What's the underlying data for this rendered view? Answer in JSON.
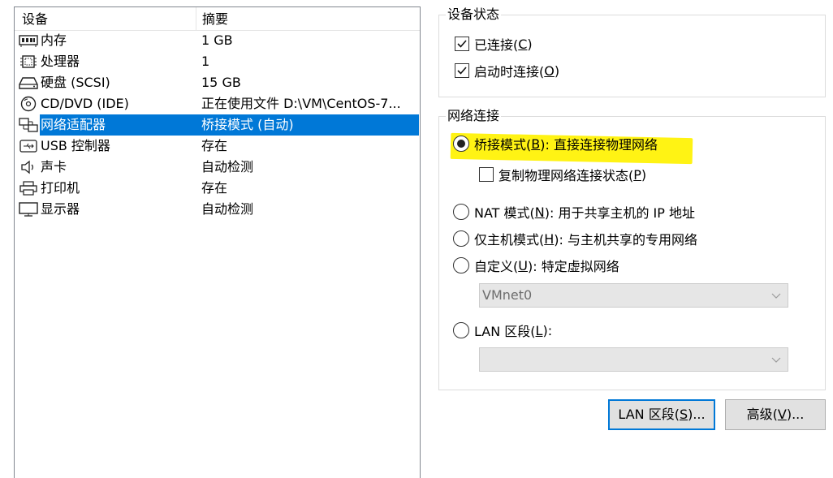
{
  "device_list": {
    "header": {
      "device": "设备",
      "summary": "摘要"
    },
    "rows": [
      {
        "icon": "memory-icon",
        "name": "内存",
        "summary": "1 GB",
        "selected": false
      },
      {
        "icon": "processor-icon",
        "name": "处理器",
        "summary": "1",
        "selected": false
      },
      {
        "icon": "hard-disk-icon",
        "name": "硬盘 (SCSI)",
        "summary": "15 GB",
        "selected": false
      },
      {
        "icon": "cd-dvd-icon",
        "name": "CD/DVD (IDE)",
        "summary": "正在使用文件 D:\\VM\\CentOS-7...",
        "selected": false
      },
      {
        "icon": "network-adapter-icon",
        "name": "网络适配器",
        "summary": "桥接模式 (自动)",
        "selected": true
      },
      {
        "icon": "usb-icon",
        "name": "USB 控制器",
        "summary": "存在",
        "selected": false
      },
      {
        "icon": "speaker-icon",
        "name": "声卡",
        "summary": "自动检测",
        "selected": false
      },
      {
        "icon": "printer-icon",
        "name": "打印机",
        "summary": "存在",
        "selected": false
      },
      {
        "icon": "monitor-icon",
        "name": "显示器",
        "summary": "自动检测",
        "selected": false
      }
    ]
  },
  "device_status": {
    "title": "设备状态",
    "connected": {
      "label": "已连接(",
      "key": "C",
      "suffix": ")",
      "checked": true
    },
    "connect_at_power_on": {
      "label": "启动时连接(",
      "key": "O",
      "suffix": ")",
      "checked": true
    }
  },
  "network_connection": {
    "title": "网络连接",
    "bridged": {
      "label": "桥接模式(",
      "key": "B",
      "suffix": "): 直接连接物理网络",
      "checked": true
    },
    "replicate": {
      "label": "复制物理网络连接状态(",
      "key": "P",
      "suffix": ")",
      "checked": false
    },
    "nat": {
      "label": "NAT 模式(",
      "key": "N",
      "suffix": "): 用于共享主机的 IP 地址",
      "checked": false
    },
    "host_only": {
      "label": "仅主机模式(",
      "key": "H",
      "suffix": "): 与主机共享的专用网络",
      "checked": false
    },
    "custom": {
      "label": "自定义(",
      "key": "U",
      "suffix": "): 特定虚拟网络",
      "checked": false
    },
    "custom_select": {
      "value": "VMnet0"
    },
    "lan_segment": {
      "label": "LAN 区段(",
      "key": "L",
      "suffix": "):",
      "checked": false
    },
    "lan_select": {
      "value": ""
    }
  },
  "buttons": {
    "lan_segments": {
      "label": "LAN 区段(",
      "key": "S",
      "suffix": ")..."
    },
    "advanced": {
      "label": "高级(",
      "key": "V",
      "suffix": ")..."
    }
  },
  "colors": {
    "selection": "#0078d7",
    "highlight": "#fff200",
    "disabled_combo": "#e6e6e6"
  }
}
